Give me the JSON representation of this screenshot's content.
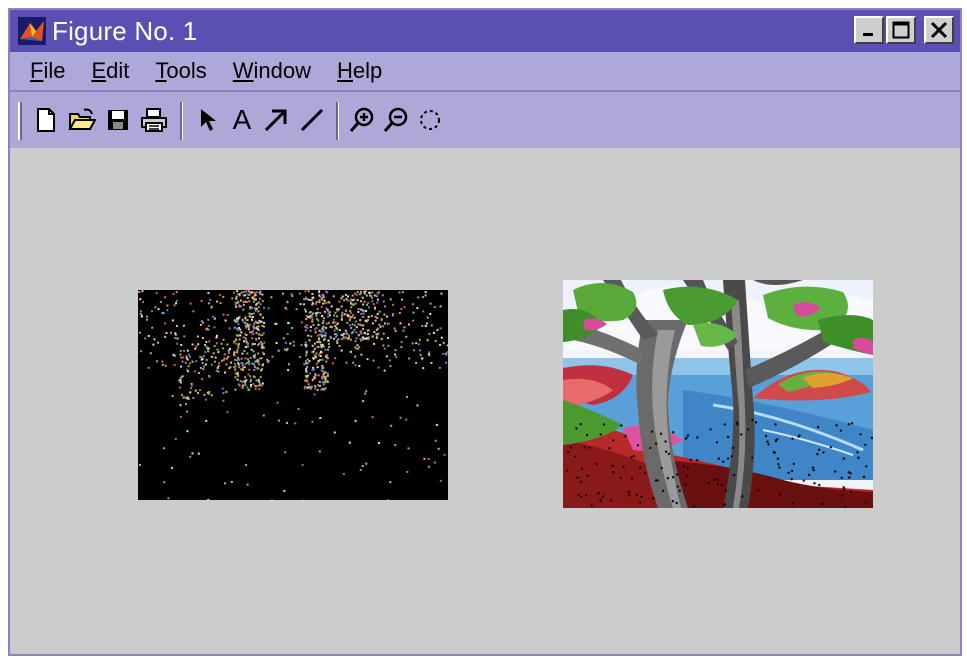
{
  "window": {
    "title": "Figure No. 1",
    "title_bar_color": "#5a4fb2",
    "menu_bar_color": "#aea8d8",
    "background_color": "#cccccc",
    "controls": [
      "minimize-icon",
      "maximize-icon",
      "close-icon"
    ]
  },
  "menu": [
    {
      "mnemonic": "F",
      "rest": "ile"
    },
    {
      "mnemonic": "E",
      "rest": "dit"
    },
    {
      "mnemonic": "T",
      "rest": "ools"
    },
    {
      "mnemonic": "W",
      "rest": "indow"
    },
    {
      "mnemonic": "H",
      "rest": "elp"
    }
  ],
  "toolbar": {
    "tools": [
      "new-file-icon",
      "open-folder-icon",
      "save-icon",
      "print-icon",
      "select-arrow-icon",
      "insert-text-icon",
      "insert-arrow-icon",
      "insert-line-icon",
      "zoom-in-icon",
      "zoom-out-icon",
      "rotate-icon"
    ],
    "text_tool_glyph": "A"
  },
  "images": [
    {
      "name": "left-image",
      "description_icon": "dark-noisy-image"
    },
    {
      "name": "right-image",
      "description_icon": "painted-tree-landscape"
    }
  ]
}
